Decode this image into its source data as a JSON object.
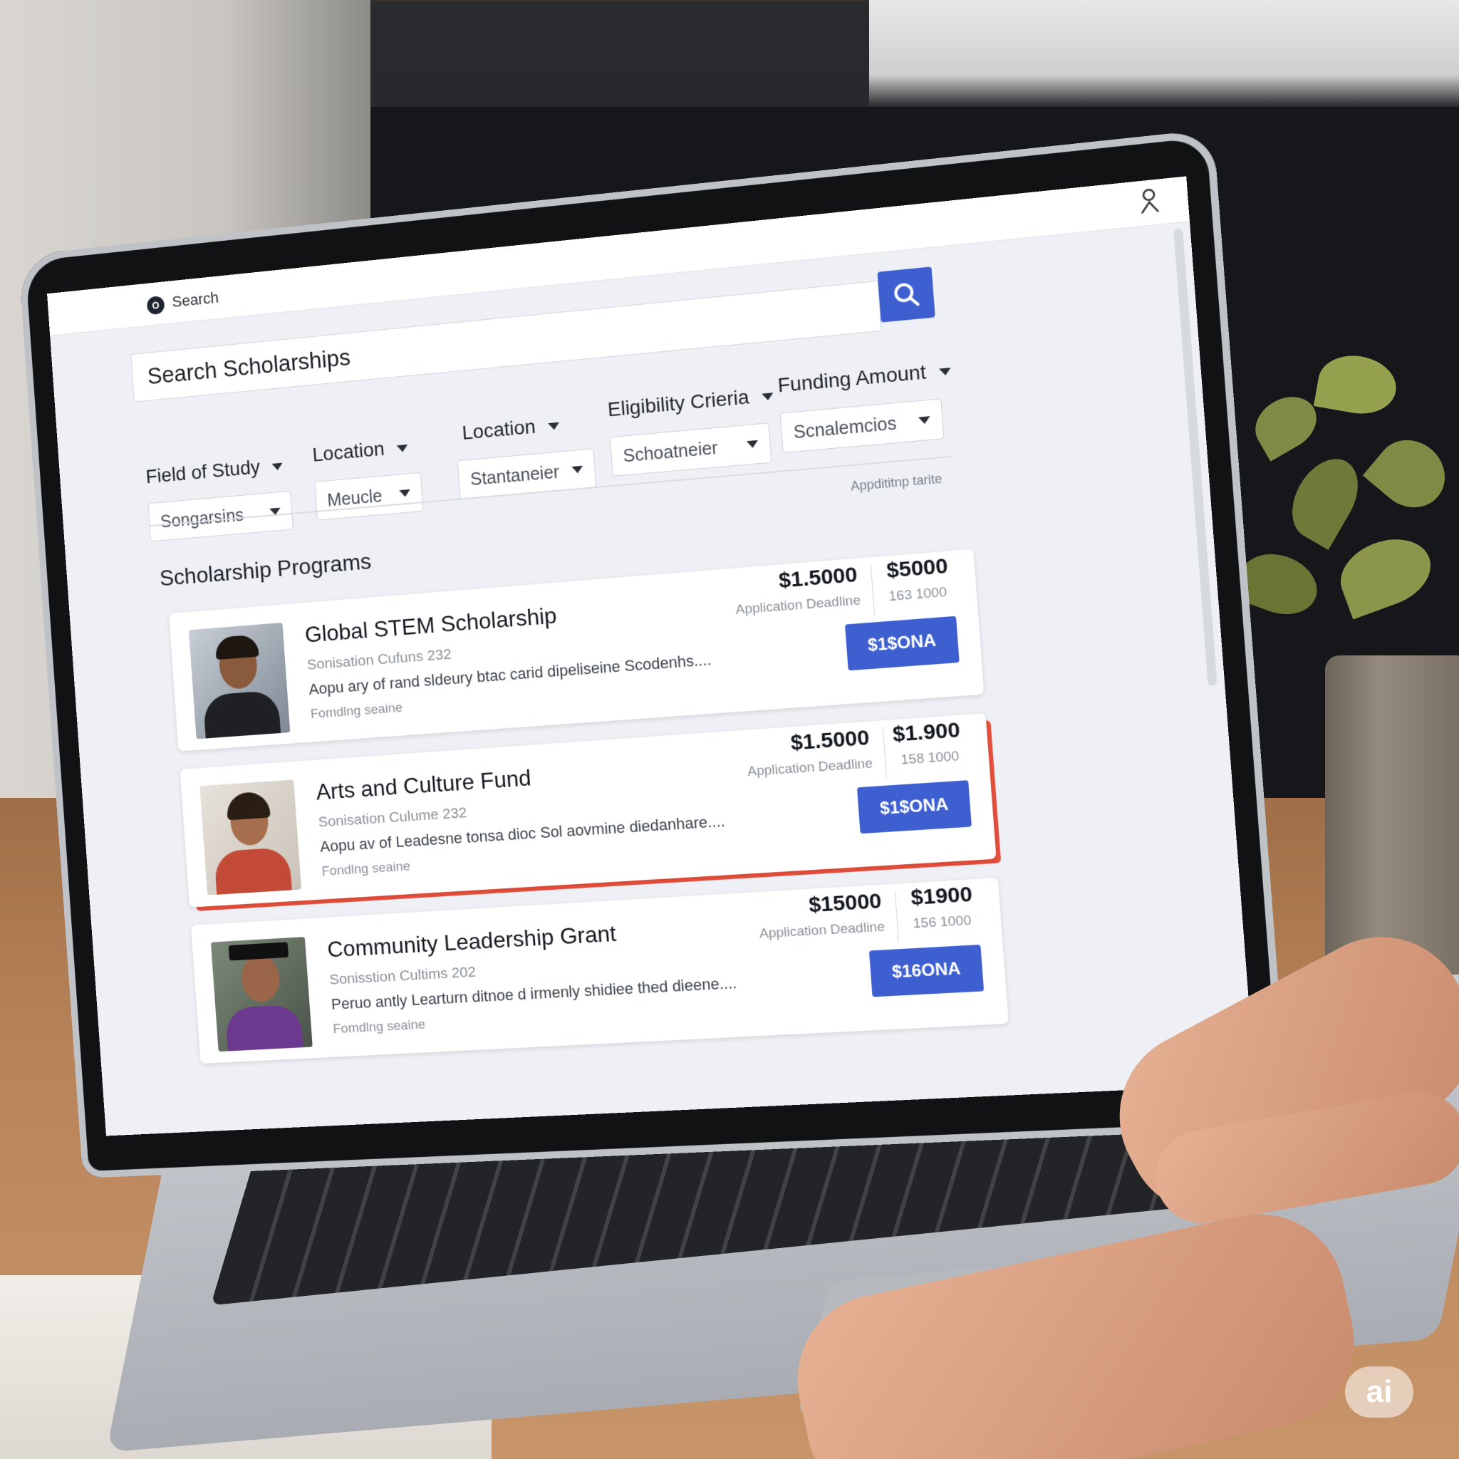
{
  "topbar": {
    "brand_icon_glyph": "O",
    "search_label": "Search",
    "account_icon": "account-icon"
  },
  "search": {
    "placeholder": "Search Scholarships",
    "button_icon": "search-icon"
  },
  "filters": [
    {
      "label": "Field of Study",
      "value": "Songarsins"
    },
    {
      "label": "Location",
      "value": "Meucle"
    },
    {
      "label": "Location",
      "value": "Stantaneier"
    },
    {
      "label": "Eligibility Crieria",
      "value": "Schoatneier"
    },
    {
      "label": "Funding Amount",
      "value": "Scnalemcios"
    }
  ],
  "sort_label": "Appdititnp tarite",
  "section_title": "Scholarship Programs",
  "cards": [
    {
      "title": "Global STEM Scholarship",
      "subtitle": "Sonisation Cufuns 232",
      "description": "Aopu ary of rand sldeury btac carid dipeliseine Scodenhs....",
      "meta": "Fomdlng seaine",
      "amount_primary": "$1.5000",
      "deadline_label": "Application Deadline",
      "amount_secondary": "$5000",
      "amount_secondary_sub": "163 1000",
      "apply_label": "$1$ONA",
      "highlighted": false,
      "photo_accent": "#1f2024"
    },
    {
      "title": "Arts and Culture Fund",
      "subtitle": "Sonisation Culume 232",
      "description": "Aopu av of Leadesne tonsa dioc Sol aovmine diedanhare....",
      "meta": "Fondlng seaine",
      "amount_primary": "$1.5000",
      "deadline_label": "Application Deadline",
      "amount_secondary": "$1.900",
      "amount_secondary_sub": "158 1000",
      "apply_label": "$1$ONA",
      "highlighted": true,
      "photo_accent": "#c24a36"
    },
    {
      "title": "Community Leadership Grant",
      "subtitle": "Sonisstion Cultims 202",
      "description": "Peruo antly Learturn ditnoe d irmenly shidiee thed dieene....",
      "meta": "Fomdlng seaine",
      "amount_primary": "$15000",
      "deadline_label": "Application Deadline",
      "amount_secondary": "$1900",
      "amount_secondary_sub": "156 1000",
      "apply_label": "$16ONA",
      "highlighted": false,
      "photo_accent": "#6b3a8e"
    }
  ],
  "watermark": "ai",
  "colors": {
    "accent": "#3e5fcf",
    "highlight": "#e8503d",
    "screen_bg": "#eef0f5"
  }
}
